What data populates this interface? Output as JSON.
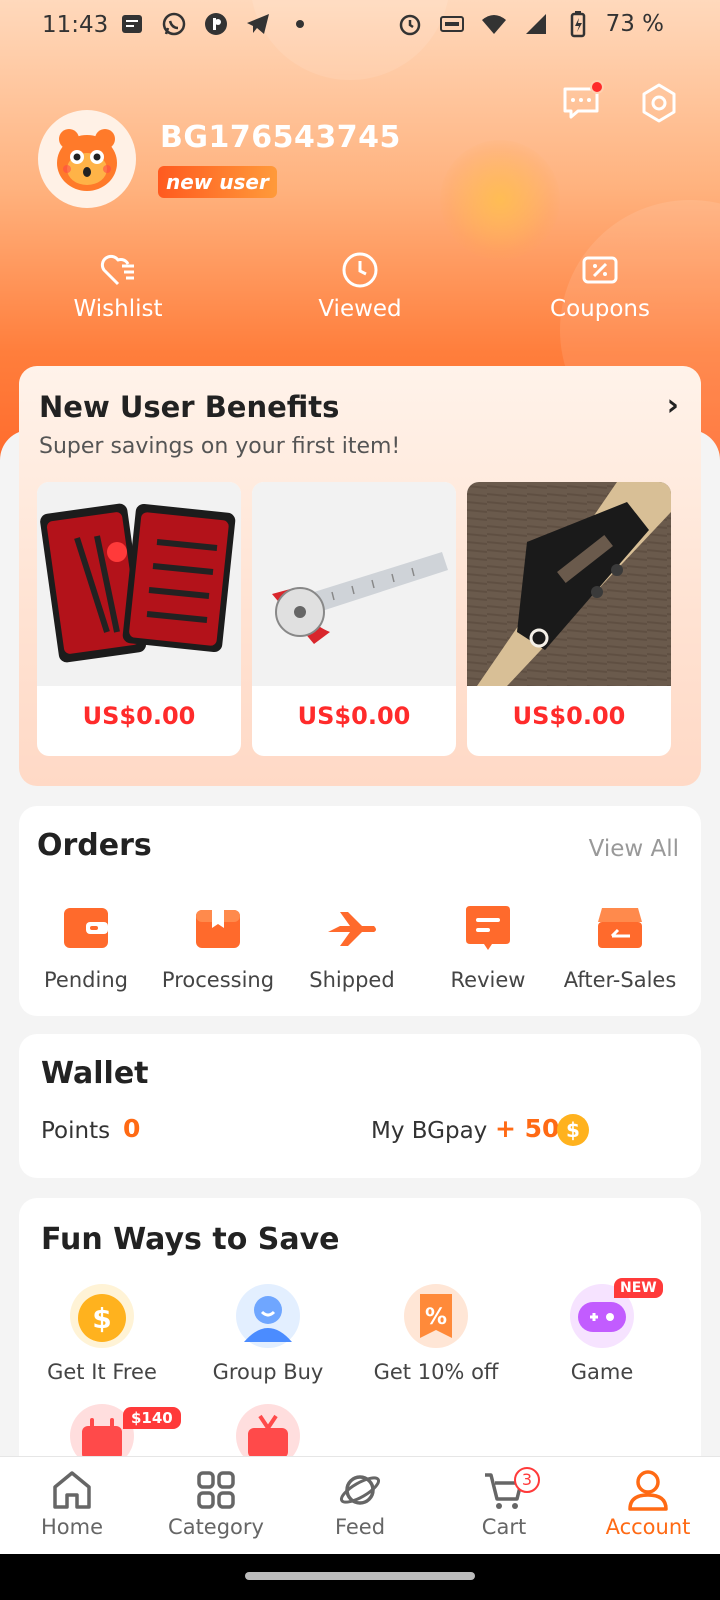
{
  "status_bar": {
    "time": "11:43",
    "battery": "73 %"
  },
  "profile": {
    "username": "BG176543745",
    "tag": "new user"
  },
  "quick_links": [
    {
      "label": "Wishlist",
      "icon": "heart-list-icon"
    },
    {
      "label": "Viewed",
      "icon": "clock-icon"
    },
    {
      "label": "Coupons",
      "icon": "coupon-icon"
    }
  ],
  "benefits": {
    "title": "New User Benefits",
    "subtitle": "Super savings on your first item!",
    "products": [
      {
        "price": "US$0.00",
        "image": "manicure-kit"
      },
      {
        "price": "US$0.00",
        "image": "ruler-protractor"
      },
      {
        "price": "US$0.00",
        "image": "black-jig"
      }
    ]
  },
  "orders": {
    "title": "Orders",
    "view_all": "View All",
    "items": [
      {
        "label": "Pending",
        "icon": "wallet-icon"
      },
      {
        "label": "Processing",
        "icon": "box-icon"
      },
      {
        "label": "Shipped",
        "icon": "plane-icon"
      },
      {
        "label": "Review",
        "icon": "chat-icon"
      },
      {
        "label": "After-Sales",
        "icon": "return-box-icon"
      }
    ]
  },
  "wallet": {
    "title": "Wallet",
    "points_label": "Points",
    "points_value": "0",
    "bgpay_label": "My BGpay",
    "bgpay_value": "+ 50",
    "coin_symbol": "$"
  },
  "fun": {
    "title": "Fun Ways to Save",
    "items": [
      {
        "label": "Get It Free",
        "icon": "dollar-coin-icon"
      },
      {
        "label": "Group Buy",
        "icon": "person-icon"
      },
      {
        "label": "Get 10% off",
        "icon": "percent-tag-icon"
      },
      {
        "label": "Game",
        "icon": "gamepad-icon",
        "badge": "NEW"
      },
      {
        "label": "",
        "icon": "calendar-icon",
        "badge": "$140"
      },
      {
        "label": "",
        "icon": "tv-icon"
      }
    ]
  },
  "nav": [
    {
      "label": "Home",
      "icon": "home-icon"
    },
    {
      "label": "Category",
      "icon": "grid-icon"
    },
    {
      "label": "Feed",
      "icon": "planet-icon"
    },
    {
      "label": "Cart",
      "icon": "cart-icon",
      "badge": "3"
    },
    {
      "label": "Account",
      "icon": "person-icon",
      "active": true
    }
  ],
  "colors": {
    "accent": "#ff6a14",
    "price_red": "#ff2b2b"
  }
}
